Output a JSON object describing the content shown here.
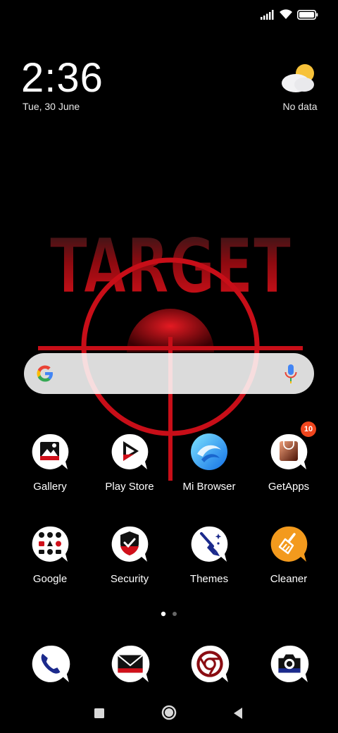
{
  "status_bar": {
    "signal_icon": "signal-bars-icon",
    "wifi_icon": "wifi-icon",
    "battery_icon": "battery-full-icon"
  },
  "clock_widget": {
    "time": "2:36",
    "date": "Tue, 30 June",
    "weather_icon": "partly-cloudy-icon",
    "weather_text": "No data"
  },
  "wallpaper": {
    "text": "TARGET",
    "accent": "#d0101a"
  },
  "search_bar": {
    "logo": "google-g-icon",
    "mic": "microphone-icon"
  },
  "apps": [
    {
      "label": "Gallery",
      "icon": "gallery-icon"
    },
    {
      "label": "Play Store",
      "icon": "play-store-icon"
    },
    {
      "label": "Mi Browser",
      "icon": "mi-browser-icon"
    },
    {
      "label": "GetApps",
      "icon": "getapps-icon",
      "badge": "10"
    },
    {
      "label": "Google",
      "icon": "google-folder-icon"
    },
    {
      "label": "Security",
      "icon": "security-icon"
    },
    {
      "label": "Themes",
      "icon": "themes-icon"
    },
    {
      "label": "Cleaner",
      "icon": "cleaner-icon"
    }
  ],
  "page_indicator": {
    "pages": 2,
    "current": 1
  },
  "dock": [
    {
      "icon": "phone-icon"
    },
    {
      "icon": "messaging-icon"
    },
    {
      "icon": "chrome-icon"
    },
    {
      "icon": "camera-icon"
    }
  ],
  "nav_bar": {
    "recents": "recents-square-icon",
    "home": "home-circle-icon",
    "back": "back-triangle-icon"
  },
  "colors": {
    "accent_red": "#d0101a",
    "badge": "#f0461e",
    "cleaner_orange": "#f39a1d"
  }
}
